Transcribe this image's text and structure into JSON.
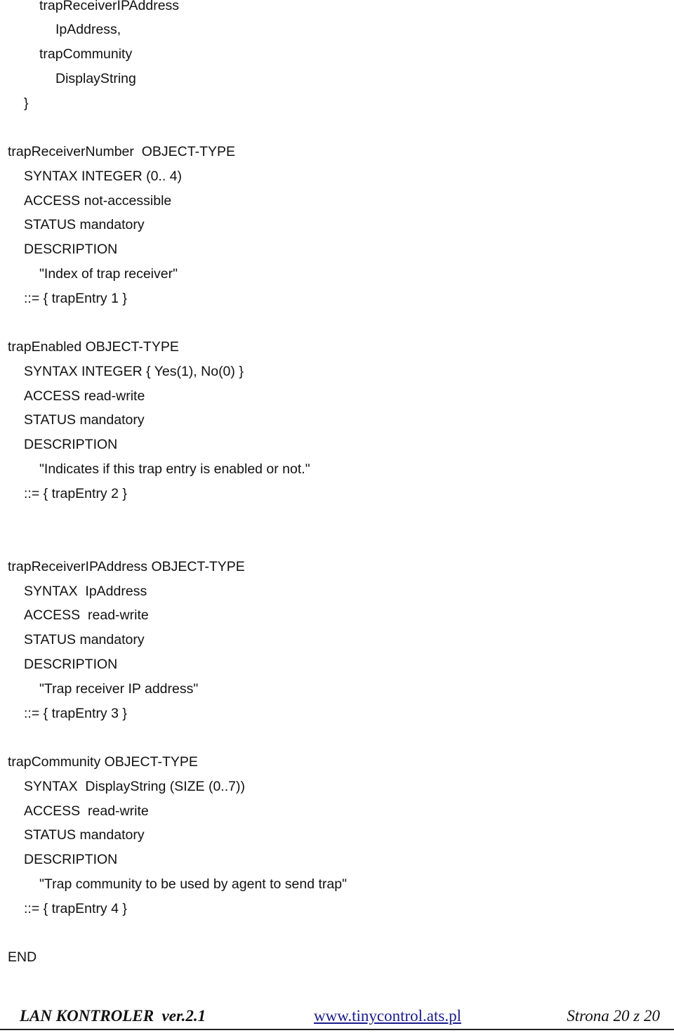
{
  "document": {
    "lines": [
      {
        "text": "trapReceiverIPAddress",
        "indent": 2
      },
      {
        "text": "IpAddress,",
        "indent": 3
      },
      {
        "text": "trapCommunity",
        "indent": 2
      },
      {
        "text": "DisplayString",
        "indent": 3
      },
      {
        "text": "}",
        "indent": 1
      },
      {
        "text": "trapReceiverNumber  OBJECT-TYPE",
        "indent": 0
      },
      {
        "text": "SYNTAX INTEGER (0.. 4)",
        "indent": 1
      },
      {
        "text": "ACCESS not-accessible",
        "indent": 1
      },
      {
        "text": "STATUS mandatory",
        "indent": 1
      },
      {
        "text": "DESCRIPTION",
        "indent": 1
      },
      {
        "text": "\"Index of trap receiver\"",
        "indent": 2
      },
      {
        "text": "::= { trapEntry 1 }",
        "indent": 1
      },
      {
        "text": "trapEnabled OBJECT-TYPE",
        "indent": 0
      },
      {
        "text": "SYNTAX INTEGER { Yes(1), No(0) }",
        "indent": 1
      },
      {
        "text": "ACCESS read-write",
        "indent": 1
      },
      {
        "text": "STATUS mandatory",
        "indent": 1
      },
      {
        "text": "DESCRIPTION",
        "indent": 1
      },
      {
        "text": "\"Indicates if this trap entry is enabled or not.\"",
        "indent": 2
      },
      {
        "text": "::= { trapEntry 2 }",
        "indent": 1
      },
      {
        "text": "trapReceiverIPAddress OBJECT-TYPE",
        "indent": 0
      },
      {
        "text": "SYNTAX  IpAddress",
        "indent": 1
      },
      {
        "text": "ACCESS  read-write",
        "indent": 1
      },
      {
        "text": "STATUS mandatory",
        "indent": 1
      },
      {
        "text": "DESCRIPTION",
        "indent": 1
      },
      {
        "text": "\"Trap receiver IP address\"",
        "indent": 2
      },
      {
        "text": "::= { trapEntry 3 }",
        "indent": 1
      },
      {
        "text": "trapCommunity OBJECT-TYPE",
        "indent": 0
      },
      {
        "text": "SYNTAX  DisplayString (SIZE (0..7))",
        "indent": 1
      },
      {
        "text": "ACCESS  read-write",
        "indent": 1
      },
      {
        "text": "STATUS mandatory",
        "indent": 1
      },
      {
        "text": "DESCRIPTION",
        "indent": 1
      },
      {
        "text": "\"Trap community to be used by agent to send trap\"",
        "indent": 2
      },
      {
        "text": "::= { trapEntry 4 }",
        "indent": 1
      },
      {
        "text": "END",
        "indent": 0
      }
    ]
  },
  "footer": {
    "product": "LAN KONTROLER  ver.2.1",
    "website": "www.tinycontrol.ats.pl",
    "page_label": "Strona 20 z 20"
  }
}
